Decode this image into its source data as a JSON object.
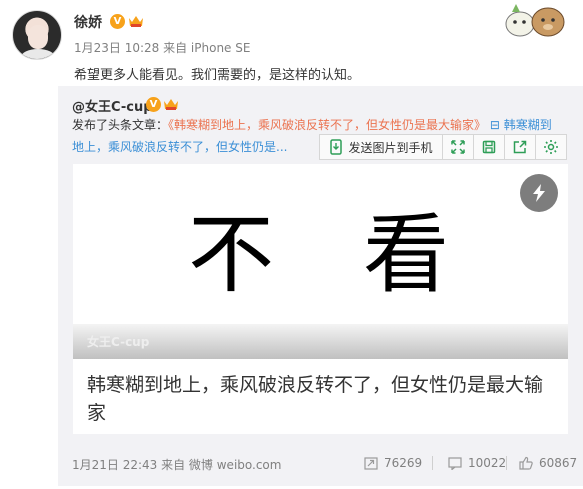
{
  "post": {
    "author": "徐娇",
    "verified_badge": "V",
    "meta": "1月23日 10:28 来自 iPhone SE",
    "text": "希望更多人能看见。我们需要的，是这样的认知。"
  },
  "repost": {
    "author": "@女王C-cup",
    "verified_badge": "V",
    "line1_prefix": "发布了头条文章：",
    "line1_link": "《韩寒糊到地上，乘风破浪反转不了，但女性仍是最大输家》",
    "line1_suffix": "  ⊟ 韩寒糊到",
    "line2": "地上，乘风破浪反转不了，但女性仍是...",
    "toolbar": {
      "send_label": "发送图片到手机",
      "icons": [
        "expand-icon",
        "save-icon",
        "share-out-icon",
        "settings-icon"
      ]
    },
    "card": {
      "image_text_left": "不",
      "image_text_right": "看",
      "image_caption": "女王C-cup",
      "title": "韩寒糊到地上，乘风破浪反转不了，但女性仍是最大输家"
    },
    "footer": {
      "time_source": "1月21日 22:43 来自 微博 weibo.com",
      "reposts": "76269",
      "comments": "10022",
      "likes": "60867"
    }
  },
  "colors": {
    "accent_orange": "#eb7350",
    "link_blue": "#3b8fd6",
    "badge_orange": "#f7a21b",
    "icon_green": "#2e9e57"
  }
}
